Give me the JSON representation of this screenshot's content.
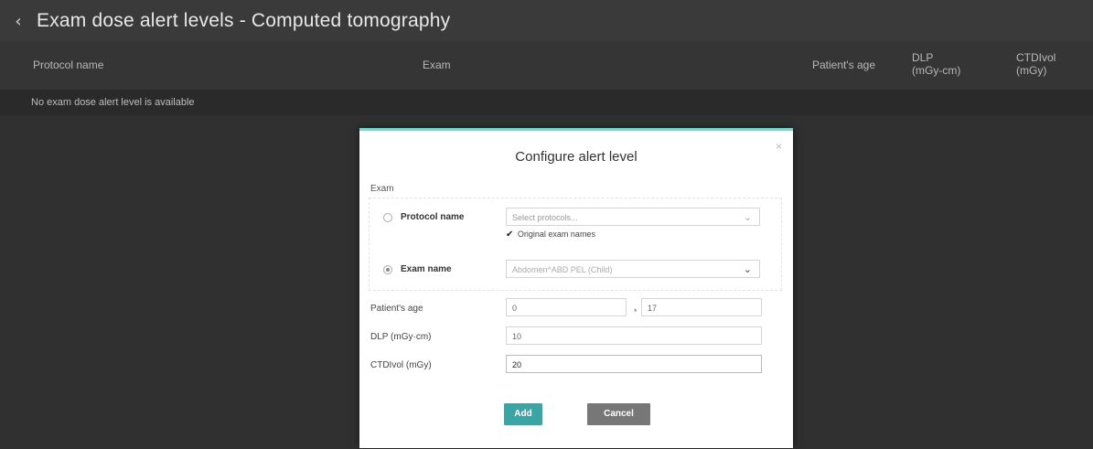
{
  "header": {
    "back_icon": "chevron-left-icon",
    "title": "Exam dose alert levels - Computed tomography"
  },
  "columns": {
    "protocol": "Protocol name",
    "exam": "Exam",
    "age": "Patient's age",
    "dlp_line1": "DLP",
    "dlp_line2": "(mGy-cm)",
    "ctdi_line1": "CTDIvol",
    "ctdi_line2": "(mGy)"
  },
  "empty_message": "No exam dose alert level is available",
  "dialog": {
    "title": "Configure alert level",
    "close": "×",
    "exam_section": "Exam",
    "protocol_option": "Protocol name",
    "protocol_select": {
      "value": "Select protocols...",
      "selected": false
    },
    "original_names": {
      "check": "✔",
      "label": "Original exam names",
      "checked": true
    },
    "exam_option": "Exam name",
    "exam_select": {
      "value": "Abdomen^ABD PEL (Child)",
      "selected": true
    },
    "age_label": "Patient's age",
    "age_from": "0",
    "age_sep": "*",
    "age_to": "17",
    "dlp_label": "DLP (mGy·cm)",
    "dlp_value": "10",
    "ctdi_label": "CTDIvol (mGy)",
    "ctdi_value": "20",
    "add_label": "Add",
    "cancel_label": "Cancel"
  },
  "colors": {
    "accent": "#3aa5a4",
    "cancel": "#777777",
    "modal_top": "#7ed3c7"
  }
}
